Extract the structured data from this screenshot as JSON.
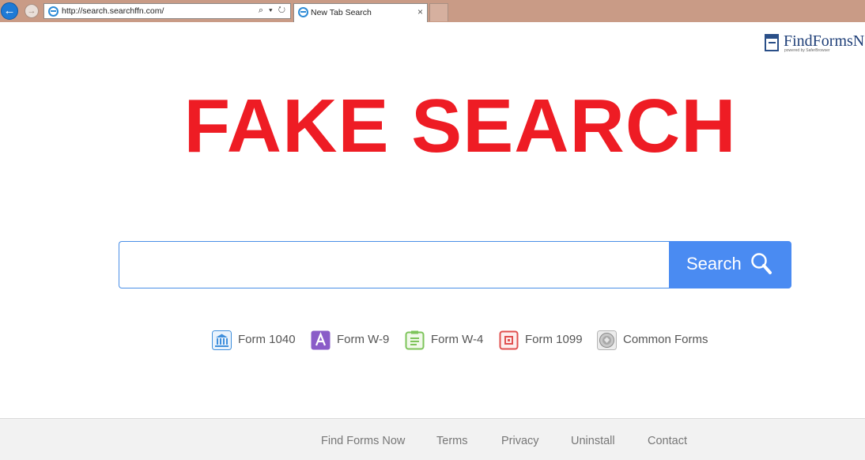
{
  "browser": {
    "url": "http://search.searchffn.com/",
    "tab_title": "New Tab Search",
    "tab_close": "×",
    "back_glyph": "←",
    "forward_glyph": "→",
    "address_tools": "⌕ ▾ ↻"
  },
  "logo": {
    "text": "FindFormsN",
    "subtext": "powered by SaferBrowser"
  },
  "overlay": {
    "headline": "FAKE SEARCH"
  },
  "search": {
    "input_value": "",
    "button_label": "Search"
  },
  "forms": [
    {
      "label": "Form 1040",
      "icon": "bank-icon",
      "color": "#3f8fdc"
    },
    {
      "label": "Form W-9",
      "icon": "letter-a-icon",
      "color": "#8a5cc8"
    },
    {
      "label": "Form W-4",
      "icon": "notepad-icon",
      "color": "#7dc45a"
    },
    {
      "label": "Form 1099",
      "icon": "calendar-icon",
      "color": "#e0504f"
    },
    {
      "label": "Common Forms",
      "icon": "seal-icon",
      "color": "#9a9a9a"
    }
  ],
  "footer": {
    "links": [
      "Find Forms Now",
      "Terms",
      "Privacy",
      "Uninstall",
      "Contact"
    ]
  }
}
